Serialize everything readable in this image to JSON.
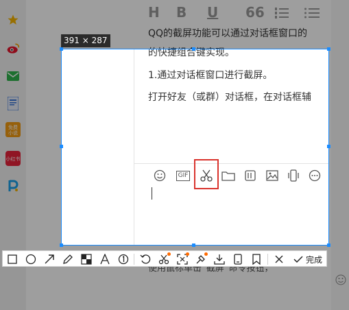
{
  "selection": {
    "size_label": "391 × 287"
  },
  "document": {
    "lines": [
      "QQ的截屏功能可以通过对话框窗口的",
      "的快捷组合键实现。",
      "1.通过对话框窗口进行截屏。",
      "打开好友（或群）对话框，在对话框辅"
    ],
    "bottom_line": "使用鼠标单击“截屏”命令按钮，"
  },
  "top_toolbar": {
    "labels": [
      "H",
      "B",
      "U",
      "66"
    ]
  },
  "sidebar": {
    "badge_text": "免费小说",
    "red_text": "小红书"
  },
  "chat_toolbar": {
    "gif_label": "GIF"
  },
  "screenshot_toolbar": {
    "done_label": "完成"
  },
  "colors": {
    "selection": "#1a8cff",
    "highlight": "#d9322c",
    "dot": "#ff6a00"
  }
}
